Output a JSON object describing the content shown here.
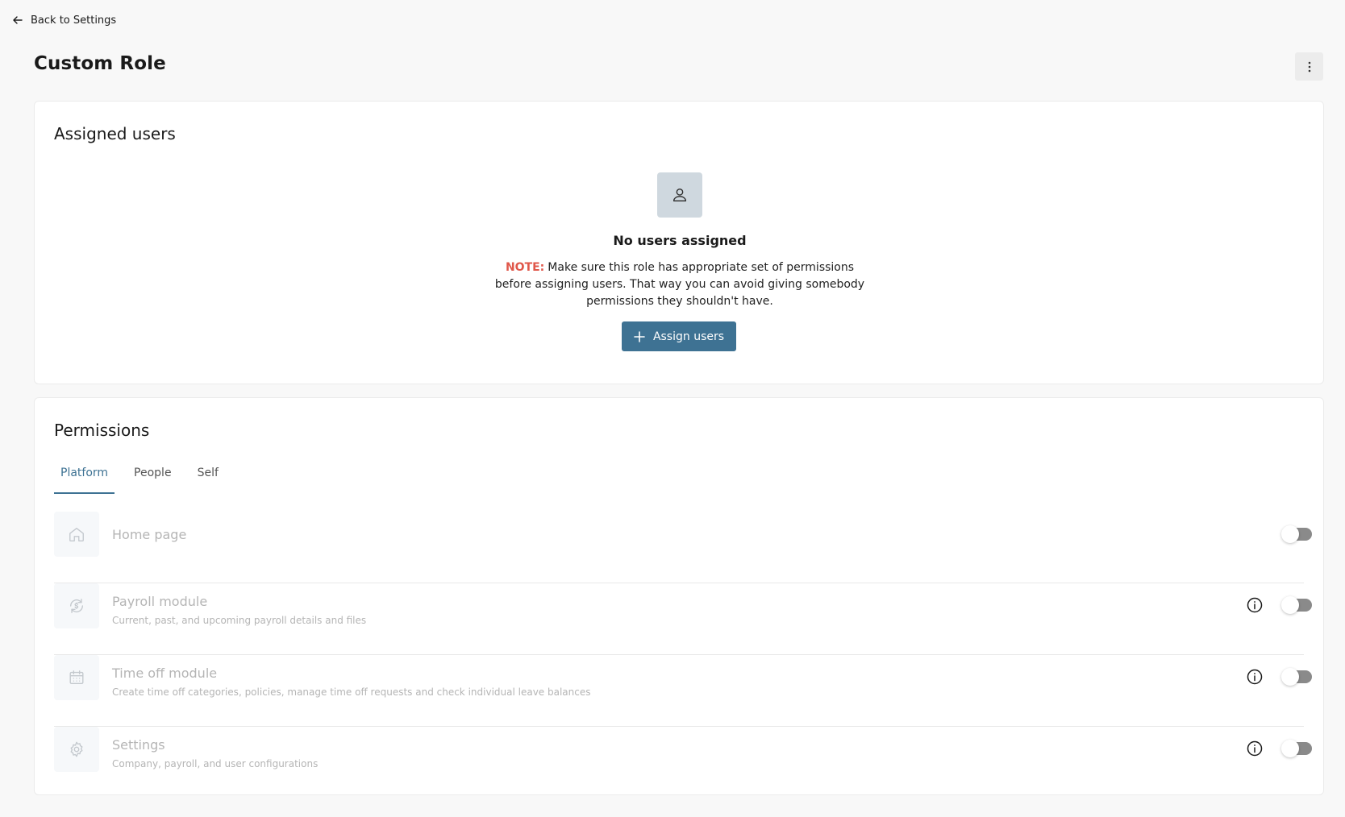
{
  "header": {
    "back_label": "Back to Settings",
    "title": "Custom Role"
  },
  "assigned_users": {
    "title": "Assigned users",
    "empty_title": "No users assigned",
    "note_label": "NOTE:",
    "note_text": "Make sure this role has appropriate set of permissions before assigning users. That way you can avoid giving somebody permissions they shouldn't have.",
    "assign_label": "Assign users"
  },
  "permissions": {
    "title": "Permissions",
    "tabs": [
      {
        "label": "Platform",
        "active": true
      },
      {
        "label": "People",
        "active": false
      },
      {
        "label": "Self",
        "active": false
      }
    ],
    "items": [
      {
        "title": "Home page",
        "description": "",
        "icon": "home-icon",
        "has_info": false,
        "enabled": false
      },
      {
        "title": "Payroll module",
        "description": "Current, past, and upcoming payroll details and files",
        "icon": "payroll-icon",
        "has_info": true,
        "enabled": false
      },
      {
        "title": "Time off module",
        "description": "Create time off categories, policies, manage time off requests and check individual leave balances",
        "icon": "calendar-icon",
        "has_info": true,
        "enabled": false
      },
      {
        "title": "Settings",
        "description": "Company, payroll, and user configurations",
        "icon": "gear-icon",
        "has_info": true,
        "enabled": false
      }
    ]
  },
  "colors": {
    "accent": "#3e7293",
    "note": "#e0574a",
    "disabled_text": "#b5b5b5",
    "toggle_off": "#8a8a8a"
  }
}
